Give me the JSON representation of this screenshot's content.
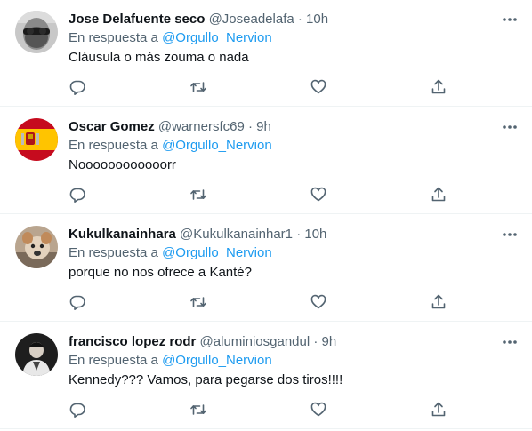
{
  "tweets": [
    {
      "name": "Jose Delafuente seco",
      "handle": "@Joseadelafa",
      "separator": "·",
      "time": "10h",
      "reply_prefix": "En respuesta a",
      "reply_to": "@Orgullo_Nervion",
      "text": "Cláusula o más zouma o nada"
    },
    {
      "name": "Oscar Gomez",
      "handle": "@warnersfc69",
      "separator": "·",
      "time": "9h",
      "reply_prefix": "En respuesta a",
      "reply_to": "@Orgullo_Nervion",
      "text": "Noooooooooooorr"
    },
    {
      "name": "Kukulkanainhara",
      "handle": "@Kukulkanainhar1",
      "separator": "·",
      "time": "10h",
      "reply_prefix": "En respuesta a",
      "reply_to": "@Orgullo_Nervion",
      "text": "porque no nos ofrece a Kanté?"
    },
    {
      "name": "francisco lopez rodr",
      "handle": "@aluminiosgandul",
      "separator": "·",
      "time": "9h",
      "reply_prefix": "En respuesta a",
      "reply_to": "@Orgullo_Nervion",
      "text": "Kennedy??? Vamos, para pegarse dos tiros!!!!"
    }
  ],
  "icons": {
    "more": "more-icon",
    "reply": "reply-icon",
    "retweet": "retweet-icon",
    "like": "like-icon",
    "share": "share-icon"
  },
  "colors": {
    "text": "#0f1419",
    "secondary": "#536471",
    "link": "#1d9bf0",
    "divider": "#eff3f4"
  }
}
